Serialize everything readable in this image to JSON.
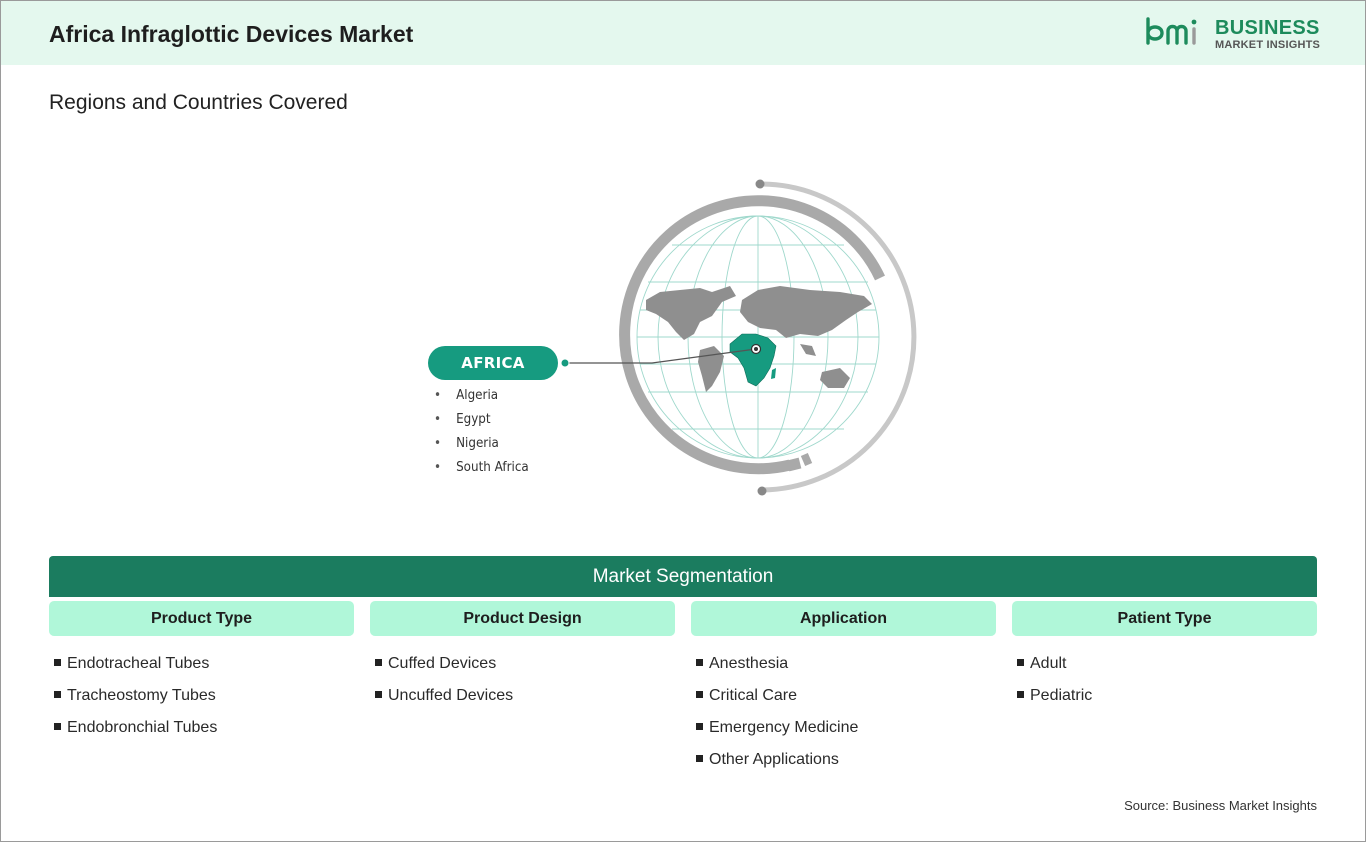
{
  "header": {
    "title": "Africa Infraglottic Devices Market",
    "logo": {
      "mark": "bmi",
      "line1": "BUSINESS",
      "line2": "MARKET INSIGHTS",
      "color": "#1d8b5c"
    }
  },
  "regions": {
    "title": "Regions and Countries Covered",
    "region_label": "AFRICA",
    "region_color": "#169b80",
    "countries": [
      "Algeria",
      "Egypt",
      "Nigeria",
      "South Africa"
    ],
    "bullet": "•"
  },
  "segmentation": {
    "title": "Market Segmentation",
    "bar_color": "#1b7c5f",
    "header_color": "#b0f7d9",
    "columns": [
      {
        "title": "Product Type",
        "items": [
          "Endotracheal Tubes",
          "Tracheostomy Tubes",
          "Endobronchial Tubes"
        ]
      },
      {
        "title": "Product Design",
        "items": [
          "Cuffed Devices",
          "Uncuffed Devices"
        ]
      },
      {
        "title": "Application",
        "items": [
          "Anesthesia",
          "Critical Care",
          "Emergency Medicine",
          "Other Applications"
        ]
      },
      {
        "title": "Patient Type",
        "items": [
          "Adult",
          "Pediatric"
        ]
      }
    ]
  },
  "source": "Source: Business Market Insights"
}
